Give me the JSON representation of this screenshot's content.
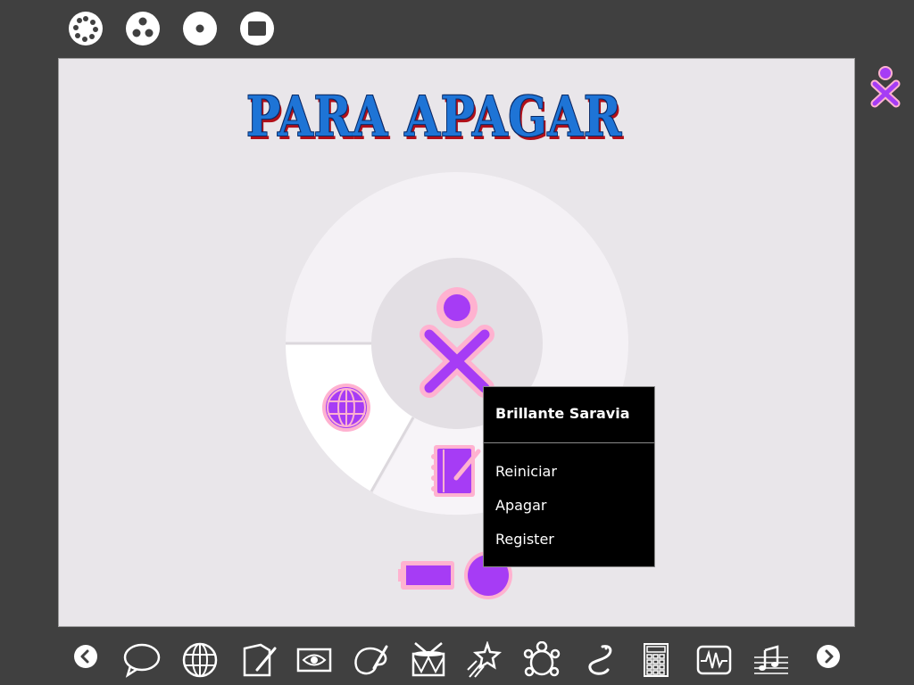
{
  "screen": {
    "title": "PARA APAGAR"
  },
  "menu": {
    "user_name": "Brillante Saravia",
    "items": [
      "Reiniciar",
      "Apagar",
      "Register"
    ]
  },
  "top_bar": {
    "buttons": [
      "neighborhood-view-icon",
      "group-view-icon",
      "home-view-icon",
      "activity-view-icon"
    ]
  },
  "dock": {
    "icons": [
      "scroll-left-icon",
      "chat-icon",
      "browse-icon",
      "write-icon",
      "record-icon",
      "paint-icon",
      "tamtam-icon",
      "turtle-art-icon",
      "memorize-icon",
      "pippy-icon",
      "calculate-icon",
      "measure-icon",
      "music-icon",
      "scroll-right-icon"
    ]
  },
  "colors": {
    "background": "#404040",
    "screen": "#e9e6ea",
    "xo_fill": "#a63cf5",
    "xo_stroke": "#ffb2d0",
    "title_blue": "#1e74d6",
    "title_shadow": "#b0101a"
  }
}
